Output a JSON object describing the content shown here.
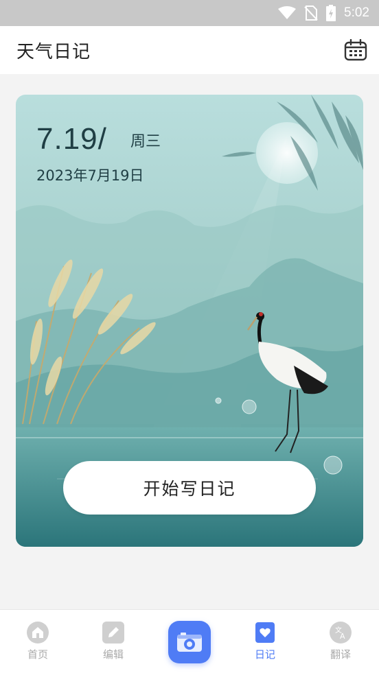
{
  "status_bar": {
    "time": "5:02"
  },
  "header": {
    "title": "天气日记"
  },
  "card": {
    "date_short": "7.19/",
    "weekday": "周三",
    "date_full": "2023年7月19日",
    "start_button": "开始写日记"
  },
  "nav": {
    "items": [
      {
        "label": "首页",
        "icon": "home-icon"
      },
      {
        "label": "编辑",
        "icon": "edit-icon"
      },
      {
        "label": "",
        "icon": "camera-icon"
      },
      {
        "label": "日记",
        "icon": "diary-heart-icon",
        "active": true
      },
      {
        "label": "翻译",
        "icon": "translate-icon"
      }
    ]
  },
  "colors": {
    "accent": "#4f7cf5",
    "inactive": "#aaaaaa"
  }
}
